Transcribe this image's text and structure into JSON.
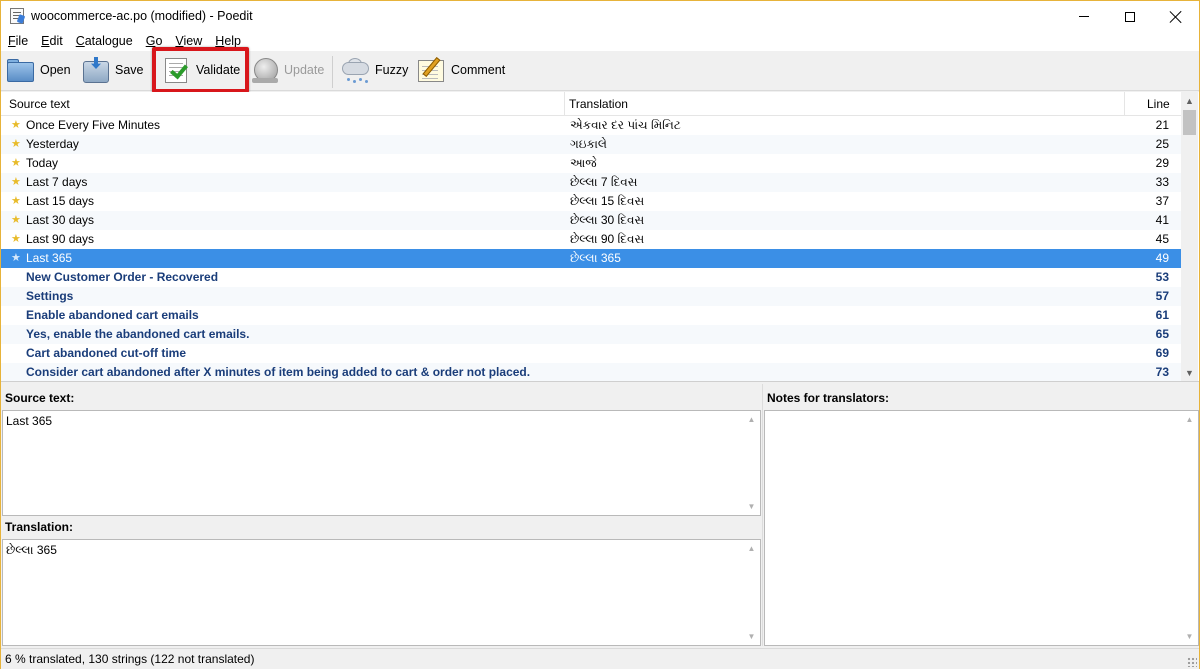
{
  "window": {
    "title": "woocommerce-ac.po (modified) - Poedit"
  },
  "menu": [
    {
      "label": "File",
      "underline": "F",
      "rest": "ile"
    },
    {
      "label": "Edit",
      "underline": "E",
      "rest": "dit"
    },
    {
      "label": "Catalogue",
      "underline": "C",
      "rest": "atalogue"
    },
    {
      "label": "Go",
      "underline": "G",
      "rest": "o"
    },
    {
      "label": "View",
      "underline": "V",
      "rest": "iew"
    },
    {
      "label": "Help",
      "underline": "H",
      "rest": "elp"
    }
  ],
  "toolbar": {
    "open": "Open",
    "save": "Save",
    "validate": "Validate",
    "update": "Update",
    "fuzzy": "Fuzzy",
    "comment": "Comment"
  },
  "list": {
    "headers": {
      "source": "Source text",
      "translation": "Translation",
      "line": "Line"
    },
    "rows": [
      {
        "source": "Once Every Five Minutes",
        "translation": "એકવાર દર પાંચ મિનિટ",
        "line": "21",
        "starred": true,
        "state": "translated"
      },
      {
        "source": "Yesterday",
        "translation": "ગઇકાલે",
        "line": "25",
        "starred": true,
        "state": "translated"
      },
      {
        "source": "Today",
        "translation": "આજે",
        "line": "29",
        "starred": true,
        "state": "translated"
      },
      {
        "source": "Last 7 days",
        "translation": "છેલ્લા 7 દિવસ",
        "line": "33",
        "starred": true,
        "state": "translated"
      },
      {
        "source": "Last 15 days",
        "translation": "છેલ્લા 15 દિવસ",
        "line": "37",
        "starred": true,
        "state": "translated"
      },
      {
        "source": "Last 30 days",
        "translation": "છેલ્લા 30 દિવસ",
        "line": "41",
        "starred": true,
        "state": "translated"
      },
      {
        "source": "Last 90 days",
        "translation": "છેલ્લા 90 દિવસ",
        "line": "45",
        "starred": true,
        "state": "translated"
      },
      {
        "source": "Last 365",
        "translation": "છેલ્લા 365",
        "line": "49",
        "starred": true,
        "state": "selected"
      },
      {
        "source": "New Customer Order - Recovered",
        "translation": "",
        "line": "53",
        "starred": false,
        "state": "untranslated"
      },
      {
        "source": "Settings",
        "translation": "",
        "line": "57",
        "starred": false,
        "state": "untranslated"
      },
      {
        "source": "Enable abandoned cart emails",
        "translation": "",
        "line": "61",
        "starred": false,
        "state": "untranslated"
      },
      {
        "source": "Yes, enable the abandoned cart emails.",
        "translation": "",
        "line": "65",
        "starred": false,
        "state": "untranslated"
      },
      {
        "source": "Cart abandoned cut-off time",
        "translation": "",
        "line": "69",
        "starred": false,
        "state": "untranslated"
      },
      {
        "source": "Consider cart abandoned after X minutes of item being added to cart & order not placed.",
        "translation": "",
        "line": "73",
        "starred": false,
        "state": "untranslated"
      }
    ]
  },
  "panes": {
    "source_label": "Source text:",
    "source_value": "Last 365",
    "translation_label": "Translation:",
    "translation_value": "છેલ્લા 365",
    "notes_label": "Notes for translators:"
  },
  "status": {
    "text": "6 % translated, 130 strings (122 not translated)"
  },
  "colors": {
    "selection": "#3b8fe6",
    "untranslated_text": "#1a3d7a",
    "highlight_frame": "#d8161b",
    "star": "#e8bb2a"
  }
}
